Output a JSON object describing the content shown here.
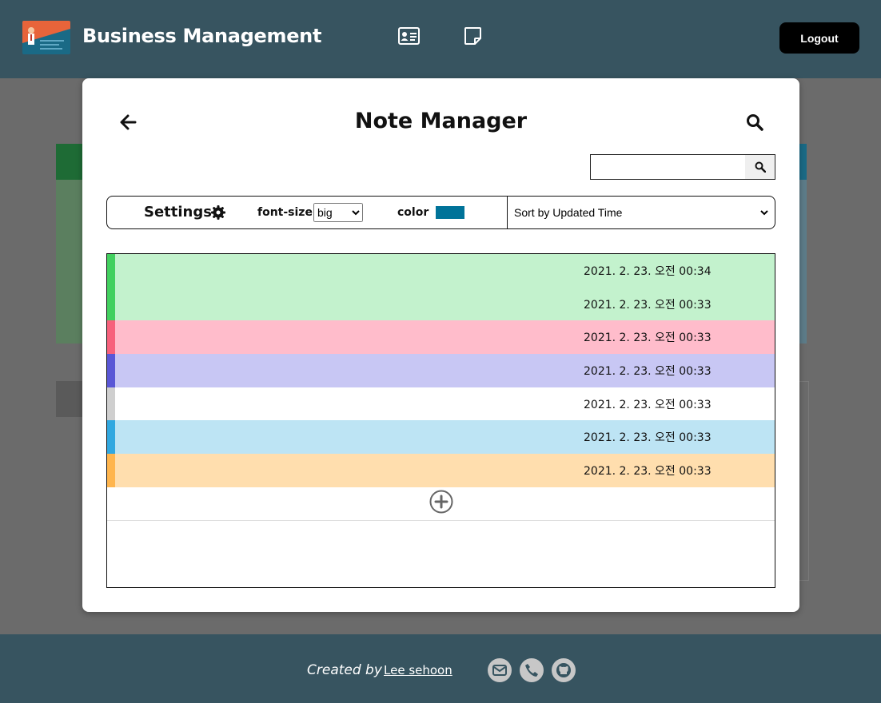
{
  "header": {
    "title": "Business Management",
    "logout_label": "Logout",
    "nav_icons": [
      "contact-card-icon",
      "sticky-note-icon"
    ]
  },
  "modal": {
    "title": "Note Manager",
    "search": {
      "value": "",
      "placeholder": ""
    },
    "settings": {
      "label": "Settings",
      "font_size_label": "font-size",
      "font_size_value": "big",
      "color_label": "color",
      "color_value": "#007399"
    },
    "sort": {
      "selected": "Sort by Updated Time"
    },
    "notes": [
      {
        "time": "2021. 2. 23. 오전 00:34",
        "bg": "#c3f2cd",
        "stripe": "#42d05f"
      },
      {
        "time": "2021. 2. 23. 오전 00:33",
        "bg": "#c3f2cd",
        "stripe": "#42d05f"
      },
      {
        "time": "2021. 2. 23. 오전 00:33",
        "bg": "#ffbccb",
        "stripe": "#f7617c"
      },
      {
        "time": "2021. 2. 23. 오전 00:33",
        "bg": "#c8c7f4",
        "stripe": "#5a57d6"
      },
      {
        "time": "2021. 2. 23. 오전 00:33",
        "bg": "#ffffff",
        "stripe": "#cfcfcf"
      },
      {
        "time": "2021. 2. 23. 오전 00:33",
        "bg": "#bde4f4",
        "stripe": "#31a8e0"
      },
      {
        "time": "2021. 2. 23. 오전 00:33",
        "bg": "#ffdeae",
        "stripe": "#ffb54d"
      }
    ]
  },
  "footer": {
    "created_by": "Created by",
    "author": "Lee sehoon",
    "socials": [
      "email-icon",
      "phone-icon",
      "github-icon"
    ]
  }
}
